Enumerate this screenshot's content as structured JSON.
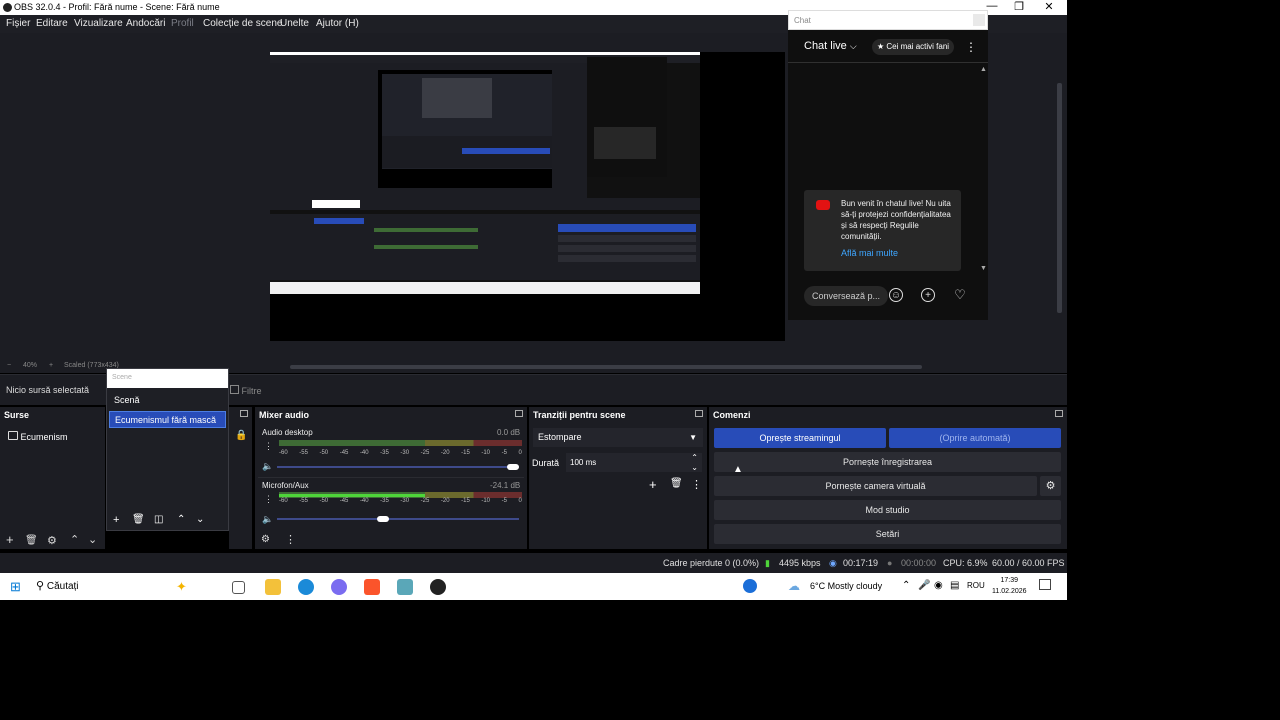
{
  "window": {
    "title": "OBS 32.0.4 - Profil: Fără nume - Scene: Fără nume",
    "controls": [
      "—",
      "❐",
      "✕"
    ]
  },
  "menu": [
    "Fișier",
    "Editare",
    "Vizualizare",
    "Andocări",
    "Profil",
    "Colecție de scene",
    "Unelte",
    "Ajutor (H)"
  ],
  "chat": {
    "window_title": "Chat",
    "mode": "Chat live",
    "fans_button": "Cei mai activi fani",
    "welcome_text": "Bun venit în chatul live! Nu uita să-ți protejezi confidențialitatea și să respecți Regulile comunității.",
    "learn_more": "Află mai multe",
    "input_placeholder": "Conversează p..."
  },
  "zoom": {
    "minus": "−",
    "level": "40%",
    "plus": "+",
    "scaled": "Scaled (773x434)"
  },
  "source_toolbar": {
    "no_source": "Nicio sursă selectată",
    "filters": "Filtre"
  },
  "scenes": {
    "header": "Scene",
    "items": [
      "Scenă",
      "Ecumenismul fără mască"
    ],
    "selected_index": 1
  },
  "sources": {
    "title": "Surse",
    "items": [
      "Ecumenism"
    ]
  },
  "mixer": {
    "title": "Mixer audio",
    "ticks": [
      "-60",
      "-55",
      "-50",
      "-45",
      "-40",
      "-35",
      "-30",
      "-25",
      "-20",
      "-15",
      "-10",
      "-5",
      "0"
    ],
    "channels": [
      {
        "name": "Audio desktop",
        "db": "0.0 dB",
        "level": 0.0,
        "volume": 1.0
      },
      {
        "name": "Microfon/Aux",
        "db": "-24.1 dB",
        "level": 0.6,
        "volume": 0.44
      }
    ]
  },
  "transitions": {
    "title": "Tranziții pentru scene",
    "selected": "Estompare",
    "duration_label": "Durată",
    "duration_value": "100 ms"
  },
  "commands": {
    "title": "Comenzi",
    "stop_stream": "Oprește streamingul",
    "auto_stop": "(Oprire automată)",
    "start_recording": "Pornește înregistrarea",
    "start_virtual_cam": "Pornește camera virtuală",
    "studio_mode": "Mod studio",
    "settings": "Setări"
  },
  "status": {
    "dropped": "Cadre pierdute 0 (0.0%)",
    "bitrate": "4495 kbps",
    "stream_time": "00:17:19",
    "rec_time": "00:00:00",
    "cpu": "CPU: 6.9%",
    "fps": "60.00 / 60.00 FPS"
  },
  "taskbar": {
    "search": "Căutați",
    "weather": "6°C  Mostly cloudy",
    "lang": "ROU",
    "time": "17:39",
    "date": "11.02.2026"
  },
  "colors": {
    "accent": "#284cb8",
    "panel": "#1c1d23",
    "meter_green": "#4ed53a"
  }
}
